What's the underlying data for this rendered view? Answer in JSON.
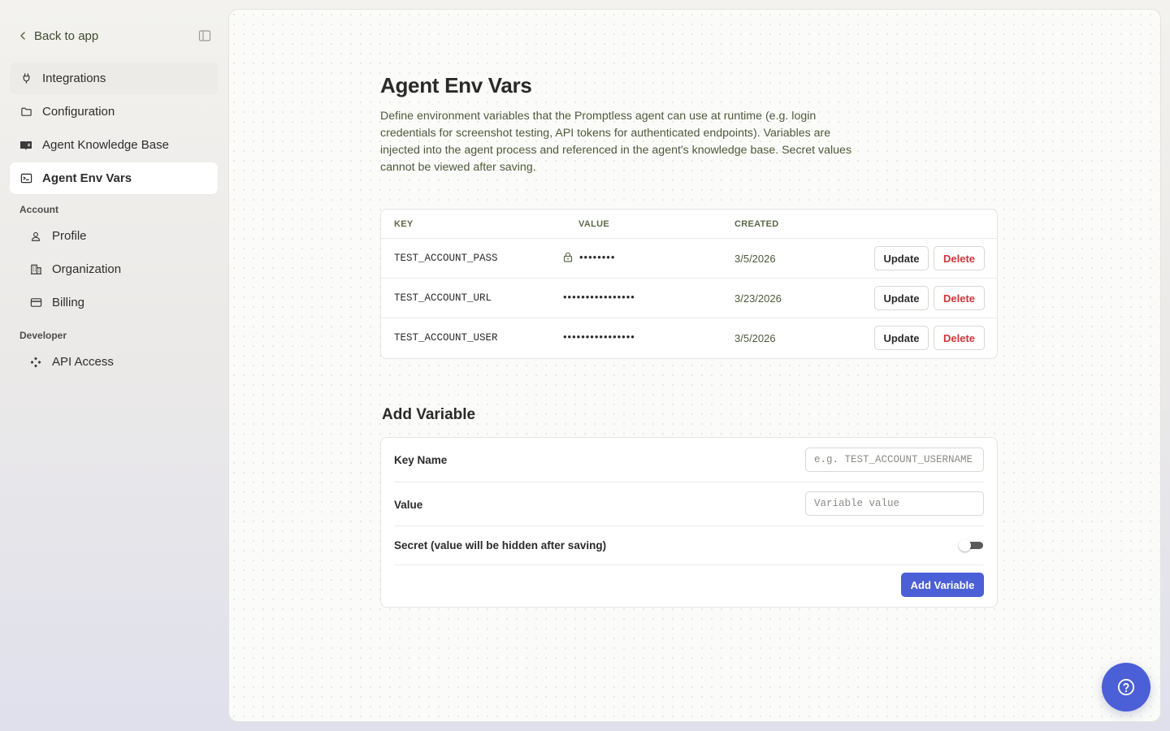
{
  "sidebar": {
    "back_label": "Back to app",
    "items": [
      {
        "label": "Integrations",
        "icon": "plug-icon"
      },
      {
        "label": "Configuration",
        "icon": "folder-icon"
      },
      {
        "label": "Agent Knowledge Base",
        "icon": "book-icon"
      },
      {
        "label": "Agent Env Vars",
        "icon": "terminal-icon"
      }
    ],
    "account_heading": "Account",
    "account_items": [
      {
        "label": "Profile",
        "icon": "user-icon"
      },
      {
        "label": "Organization",
        "icon": "building-icon"
      },
      {
        "label": "Billing",
        "icon": "credit-card-icon"
      }
    ],
    "developer_heading": "Developer",
    "developer_items": [
      {
        "label": "API Access",
        "icon": "api-icon"
      }
    ]
  },
  "main": {
    "title": "Agent Env Vars",
    "description": "Define environment variables that the Promptless agent can use at runtime (e.g. login credentials for screenshot testing, API tokens for authenticated endpoints). Variables are injected into the agent process and referenced in the agent's knowledge base. Secret values cannot be viewed after saving.",
    "table": {
      "headers": {
        "key": "KEY",
        "value": "VALUE",
        "created": "CREATED"
      },
      "rows": [
        {
          "key": "TEST_ACCOUNT_PASS",
          "value": "••••••••",
          "secret": true,
          "created": "3/5/2026"
        },
        {
          "key": "TEST_ACCOUNT_URL",
          "value": "••••••••••••••••",
          "secret": false,
          "created": "3/23/2026"
        },
        {
          "key": "TEST_ACCOUNT_USER",
          "value": "••••••••••••••••",
          "secret": false,
          "created": "3/5/2026"
        }
      ],
      "update_label": "Update",
      "delete_label": "Delete"
    },
    "add_section": {
      "title": "Add Variable",
      "key_label": "Key Name",
      "key_placeholder": "e.g. TEST_ACCOUNT_USERNAME",
      "key_value": "",
      "value_label": "Value",
      "value_placeholder": "Variable value",
      "value_value": "",
      "secret_label": "Secret (value will be hidden after saving)",
      "secret_on": false,
      "submit_label": "Add Variable"
    }
  },
  "colors": {
    "accent": "#4b5fd6",
    "danger": "#d1343c",
    "muted_text": "#4e5a3c"
  }
}
